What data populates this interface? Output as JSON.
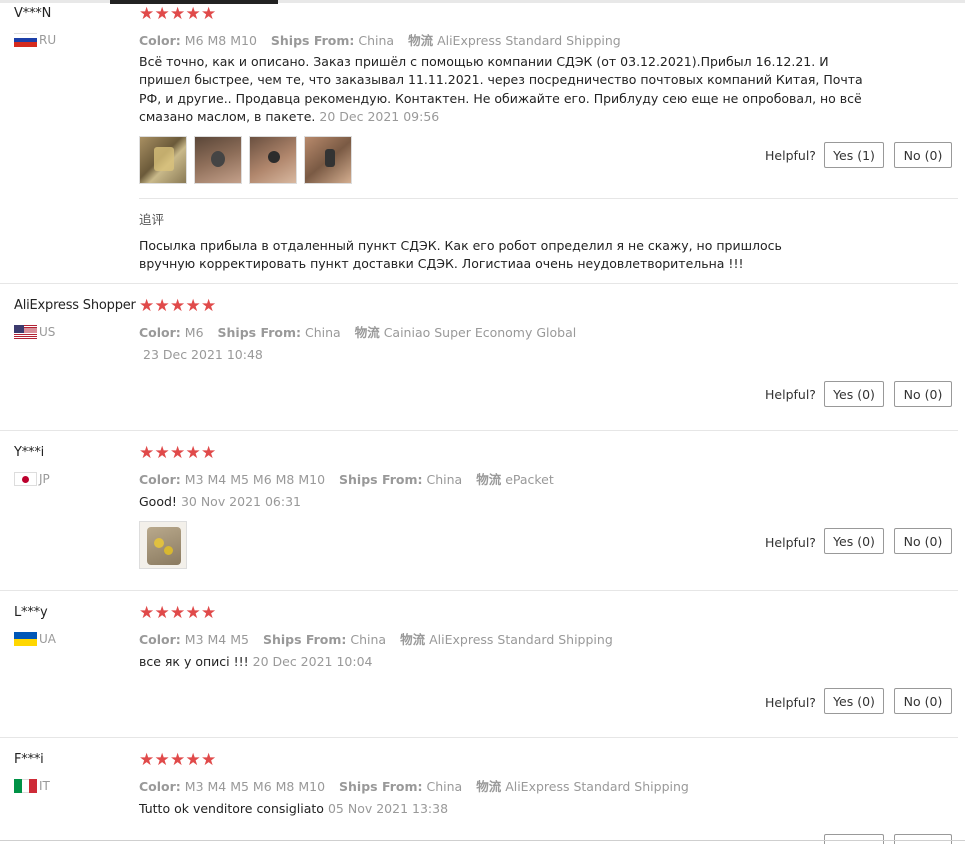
{
  "labels": {
    "color": "Color:",
    "ships_from": "Ships From:",
    "logistics": "物流",
    "helpful": "Helpful?",
    "additional_review": "追评"
  },
  "reviews": [
    {
      "user": "V***N",
      "country": "RU",
      "rating": 5,
      "color": "M6 M8 M10",
      "ships_from": "China",
      "logistics": "AliExpress Standard Shipping",
      "text": "Всё точно, как и описано. Заказ пришёл с помощью компании СДЭК (от 03.12.2021).Прибыл 16.12.21. И пришел быстрее, чем те, что заказывал 11.11.2021. через посредничество почтовых компаний Китая, Почта РФ, и другие.. Продавца рекомендую. Контактен. Не обижайте его. Приблуду сею еще не опробовал, но всё смазано маслом, в пакете.",
      "date": "20 Dec 2021 09:56",
      "yes": "Yes (1)",
      "no": "No (0)",
      "additional_text": "Посылка прибыла в отдаленный пункт СДЭК. Как его робот определил я не скажу, но пришлось вручную корректировать пункт доставки СДЭК. Логистиаа очень неудовлетворительна !!!"
    },
    {
      "user": "AliExpress Shopper",
      "country": "US",
      "rating": 5,
      "color": "M6",
      "ships_from": "China",
      "logistics": "Cainiao Super Economy Global",
      "text": "",
      "date": "23 Dec 2021 10:48",
      "yes": "Yes (0)",
      "no": "No (0)"
    },
    {
      "user": "Y***i",
      "country": "JP",
      "rating": 5,
      "color": "M3 M4 M5 M6 M8 M10",
      "ships_from": "China",
      "logistics": "ePacket",
      "text": "Good!",
      "date": "30 Nov 2021 06:31",
      "yes": "Yes (0)",
      "no": "No (0)"
    },
    {
      "user": "L***y",
      "country": "UA",
      "rating": 5,
      "color": "M3 M4 M5",
      "ships_from": "China",
      "logistics": "AliExpress Standard Shipping",
      "text": "все як у описі !!!",
      "date": "20 Dec 2021 10:04",
      "yes": "Yes (0)",
      "no": "No (0)"
    },
    {
      "user": "F***i",
      "country": "IT",
      "rating": 5,
      "color": "M3 M4 M5 M6 M8 M10",
      "ships_from": "China",
      "logistics": "AliExpress Standard Shipping",
      "text": "Tutto ok venditore consigliato",
      "date": "05 Nov 2021 13:38"
    }
  ],
  "colors": {
    "star": "#e04a4a",
    "meta_text": "#999999",
    "separator": "#e6e6e6",
    "button_border": "#999999"
  }
}
